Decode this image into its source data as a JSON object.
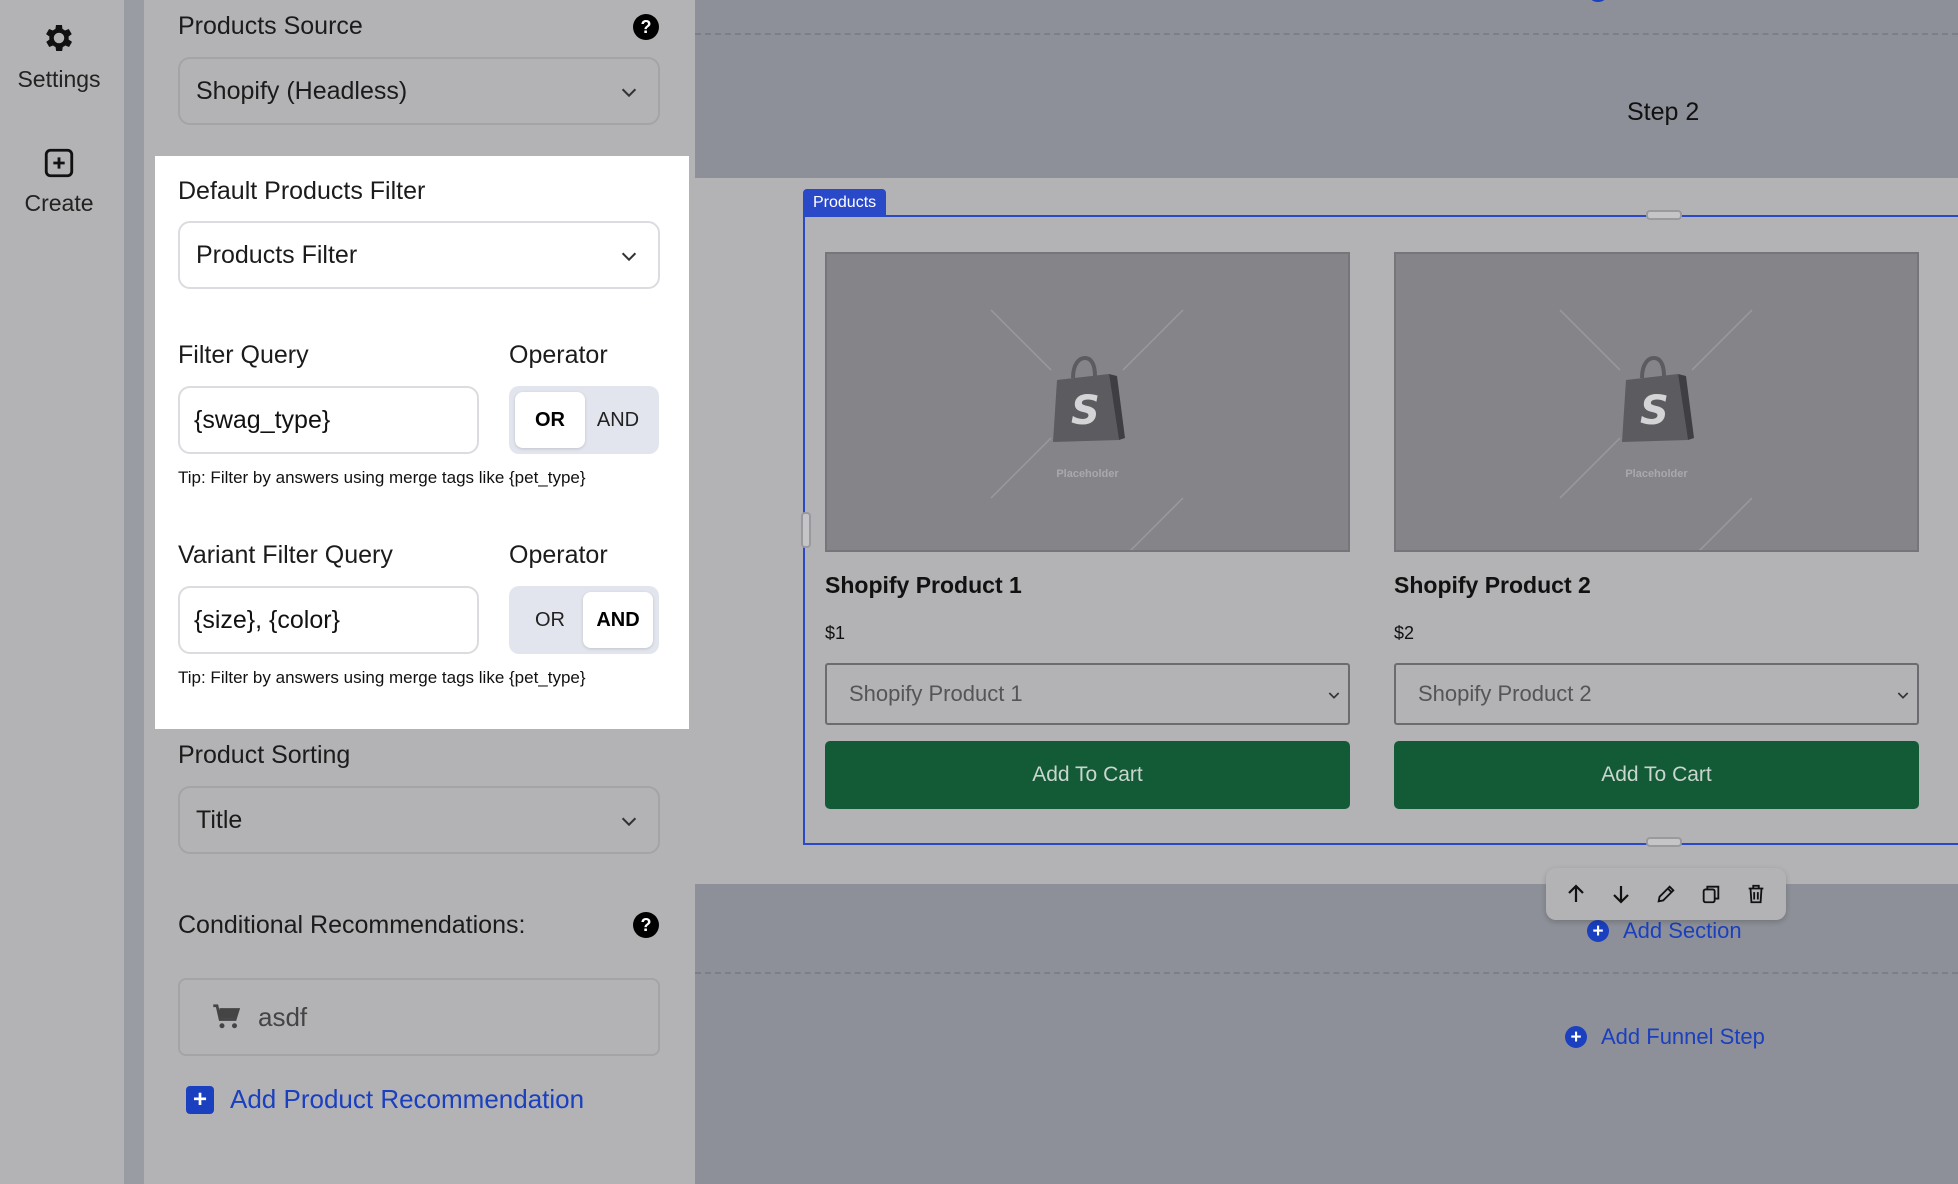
{
  "rail": {
    "settings_label": "Settings",
    "create_label": "Create"
  },
  "panel": {
    "products_source_label": "Products Source",
    "products_source_value": "Shopify (Headless)",
    "default_filter_label": "Default Products Filter",
    "default_filter_value": "Products Filter",
    "filter_query_label": "Filter Query",
    "filter_query_value": "{swag_type}",
    "operator_label": "Operator",
    "filter_operator_options": [
      "OR",
      "AND"
    ],
    "filter_operator_selected": "OR",
    "tip": "Tip: Filter by answers using merge tags like {pet_type}",
    "variant_query_label": "Variant Filter Query",
    "variant_query_value": "{size}, {color}",
    "variant_operator_label": "Operator",
    "variant_operator_options": [
      "OR",
      "AND"
    ],
    "variant_operator_selected": "AND",
    "variant_tip": "Tip: Filter by answers using merge tags like {pet_type}",
    "sorting_label": "Product Sorting",
    "sorting_value": "Title",
    "conditional_label": "Conditional Recommendations:",
    "recommendation_item": "asdf",
    "add_recommendation": "Add Product Recommendation",
    "help_glyph": "?"
  },
  "canvas": {
    "step_title": "Step 2",
    "products_tag": "Products",
    "placeholder_text": "Placeholder",
    "products": [
      {
        "title": "Shopify Product 1",
        "price": "$1",
        "variant": "Shopify Product 1",
        "button": "Add To Cart"
      },
      {
        "title": "Shopify Product 2",
        "price": "$2",
        "variant": "Shopify Product 2",
        "button": "Add To Cart"
      }
    ],
    "add_section": "Add Section",
    "add_funnel_step": "Add Funnel Step"
  },
  "colors": {
    "accent": "#1a3fbf",
    "cart_button": "#135a36",
    "panel_bg": "#b3b3b5",
    "canvas_bg": "#8e9099"
  }
}
